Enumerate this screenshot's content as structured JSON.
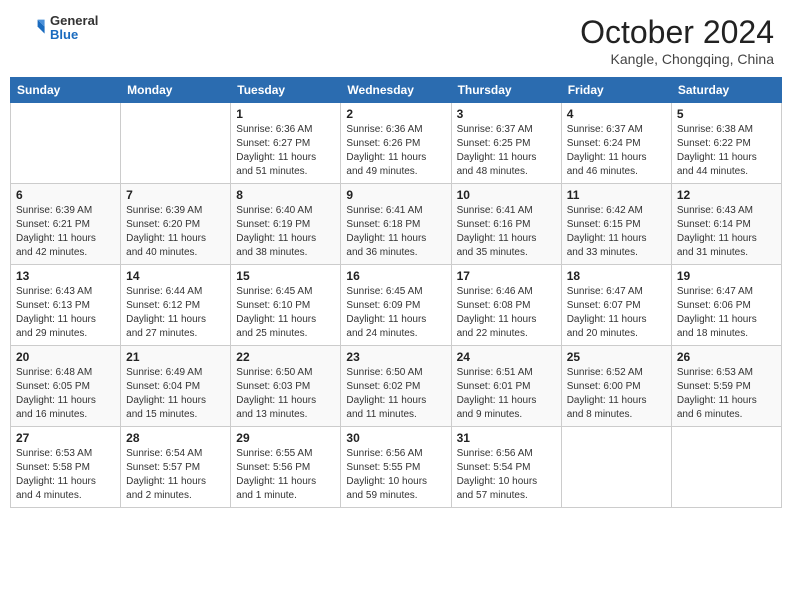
{
  "header": {
    "logo": {
      "general": "General",
      "blue": "Blue"
    },
    "title": "October 2024",
    "location": "Kangle, Chongqing, China"
  },
  "days_of_week": [
    "Sunday",
    "Monday",
    "Tuesday",
    "Wednesday",
    "Thursday",
    "Friday",
    "Saturday"
  ],
  "weeks": [
    [
      null,
      null,
      {
        "day": 1,
        "sunrise": "6:36 AM",
        "sunset": "6:27 PM",
        "daylight": "11 hours and 51 minutes."
      },
      {
        "day": 2,
        "sunrise": "6:36 AM",
        "sunset": "6:26 PM",
        "daylight": "11 hours and 49 minutes."
      },
      {
        "day": 3,
        "sunrise": "6:37 AM",
        "sunset": "6:25 PM",
        "daylight": "11 hours and 48 minutes."
      },
      {
        "day": 4,
        "sunrise": "6:37 AM",
        "sunset": "6:24 PM",
        "daylight": "11 hours and 46 minutes."
      },
      {
        "day": 5,
        "sunrise": "6:38 AM",
        "sunset": "6:22 PM",
        "daylight": "11 hours and 44 minutes."
      }
    ],
    [
      {
        "day": 6,
        "sunrise": "6:39 AM",
        "sunset": "6:21 PM",
        "daylight": "11 hours and 42 minutes."
      },
      {
        "day": 7,
        "sunrise": "6:39 AM",
        "sunset": "6:20 PM",
        "daylight": "11 hours and 40 minutes."
      },
      {
        "day": 8,
        "sunrise": "6:40 AM",
        "sunset": "6:19 PM",
        "daylight": "11 hours and 38 minutes."
      },
      {
        "day": 9,
        "sunrise": "6:41 AM",
        "sunset": "6:18 PM",
        "daylight": "11 hours and 36 minutes."
      },
      {
        "day": 10,
        "sunrise": "6:41 AM",
        "sunset": "6:16 PM",
        "daylight": "11 hours and 35 minutes."
      },
      {
        "day": 11,
        "sunrise": "6:42 AM",
        "sunset": "6:15 PM",
        "daylight": "11 hours and 33 minutes."
      },
      {
        "day": 12,
        "sunrise": "6:43 AM",
        "sunset": "6:14 PM",
        "daylight": "11 hours and 31 minutes."
      }
    ],
    [
      {
        "day": 13,
        "sunrise": "6:43 AM",
        "sunset": "6:13 PM",
        "daylight": "11 hours and 29 minutes."
      },
      {
        "day": 14,
        "sunrise": "6:44 AM",
        "sunset": "6:12 PM",
        "daylight": "11 hours and 27 minutes."
      },
      {
        "day": 15,
        "sunrise": "6:45 AM",
        "sunset": "6:10 PM",
        "daylight": "11 hours and 25 minutes."
      },
      {
        "day": 16,
        "sunrise": "6:45 AM",
        "sunset": "6:09 PM",
        "daylight": "11 hours and 24 minutes."
      },
      {
        "day": 17,
        "sunrise": "6:46 AM",
        "sunset": "6:08 PM",
        "daylight": "11 hours and 22 minutes."
      },
      {
        "day": 18,
        "sunrise": "6:47 AM",
        "sunset": "6:07 PM",
        "daylight": "11 hours and 20 minutes."
      },
      {
        "day": 19,
        "sunrise": "6:47 AM",
        "sunset": "6:06 PM",
        "daylight": "11 hours and 18 minutes."
      }
    ],
    [
      {
        "day": 20,
        "sunrise": "6:48 AM",
        "sunset": "6:05 PM",
        "daylight": "11 hours and 16 minutes."
      },
      {
        "day": 21,
        "sunrise": "6:49 AM",
        "sunset": "6:04 PM",
        "daylight": "11 hours and 15 minutes."
      },
      {
        "day": 22,
        "sunrise": "6:50 AM",
        "sunset": "6:03 PM",
        "daylight": "11 hours and 13 minutes."
      },
      {
        "day": 23,
        "sunrise": "6:50 AM",
        "sunset": "6:02 PM",
        "daylight": "11 hours and 11 minutes."
      },
      {
        "day": 24,
        "sunrise": "6:51 AM",
        "sunset": "6:01 PM",
        "daylight": "11 hours and 9 minutes."
      },
      {
        "day": 25,
        "sunrise": "6:52 AM",
        "sunset": "6:00 PM",
        "daylight": "11 hours and 8 minutes."
      },
      {
        "day": 26,
        "sunrise": "6:53 AM",
        "sunset": "5:59 PM",
        "daylight": "11 hours and 6 minutes."
      }
    ],
    [
      {
        "day": 27,
        "sunrise": "6:53 AM",
        "sunset": "5:58 PM",
        "daylight": "11 hours and 4 minutes."
      },
      {
        "day": 28,
        "sunrise": "6:54 AM",
        "sunset": "5:57 PM",
        "daylight": "11 hours and 2 minutes."
      },
      {
        "day": 29,
        "sunrise": "6:55 AM",
        "sunset": "5:56 PM",
        "daylight": "11 hours and 1 minute."
      },
      {
        "day": 30,
        "sunrise": "6:56 AM",
        "sunset": "5:55 PM",
        "daylight": "10 hours and 59 minutes."
      },
      {
        "day": 31,
        "sunrise": "6:56 AM",
        "sunset": "5:54 PM",
        "daylight": "10 hours and 57 minutes."
      },
      null,
      null
    ]
  ]
}
